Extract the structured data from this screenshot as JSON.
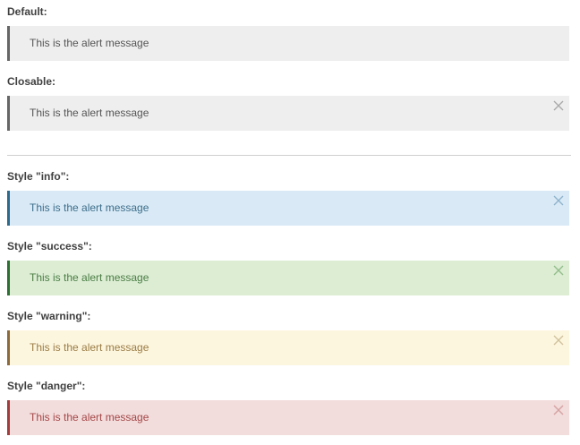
{
  "sections": [
    {
      "heading": "Default:",
      "message": "This is the alert message",
      "closable": false,
      "colors": {
        "bg": "#eeeeee",
        "border": "#666666",
        "text": "#555555",
        "close": "#aaaaaa"
      }
    },
    {
      "heading": "Closable:",
      "message": "This is the alert message",
      "closable": true,
      "colors": {
        "bg": "#eeeeee",
        "border": "#666666",
        "text": "#555555",
        "close": "#aaaaaa"
      }
    },
    {
      "heading": "Style \"info\":",
      "message": "This is the alert message",
      "closable": true,
      "colors": {
        "bg": "#d9eaf6",
        "border": "#2d6a8c",
        "text": "#3d6d8a",
        "close": "#8fb3cc"
      }
    },
    {
      "heading": "Style \"success\":",
      "message": "This is the alert message",
      "closable": true,
      "colors": {
        "bg": "#dcedd4",
        "border": "#2e6f34",
        "text": "#4b7d44",
        "close": "#93bd8b"
      }
    },
    {
      "heading": "Style \"warning\":",
      "message": "This is the alert message",
      "closable": true,
      "colors": {
        "bg": "#fdf6df",
        "border": "#8d6a3c",
        "text": "#9a7c45",
        "close": "#d0c29c"
      }
    },
    {
      "heading": "Style \"danger\":",
      "message": "This is the alert message",
      "closable": true,
      "colors": {
        "bg": "#f2dcdc",
        "border": "#a33d3d",
        "text": "#a54747",
        "close": "#d5a2a2"
      }
    }
  ]
}
